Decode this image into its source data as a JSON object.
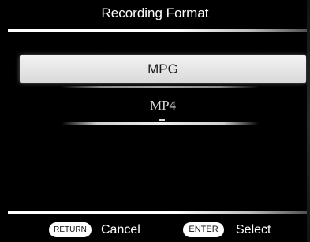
{
  "header": {
    "title": "Recording Format"
  },
  "formats": {
    "options": [
      {
        "label": "MPG",
        "selected": true
      },
      {
        "label": "MP4",
        "selected": false
      }
    ]
  },
  "footer": {
    "return_key": "RETURN",
    "return_action": "Cancel",
    "enter_key": "ENTER",
    "enter_action": "Select"
  },
  "colors": {
    "background": "#000000",
    "text": "#ffffff",
    "highlight": "#e7e7e7",
    "highlight_text": "#1a1a1a"
  }
}
